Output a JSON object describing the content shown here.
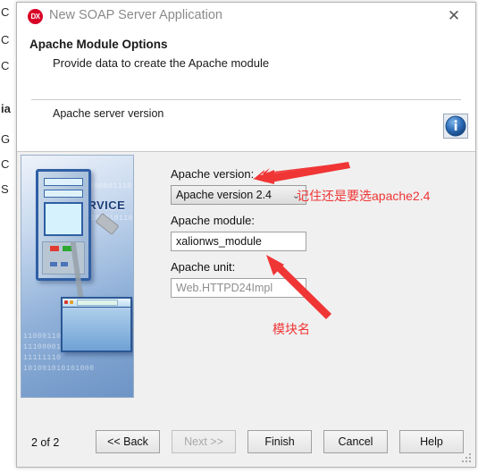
{
  "window": {
    "title": "New SOAP Server Application",
    "app_icon": "dx-logo-icon",
    "close_label": "✕"
  },
  "header": {
    "title": "Apache Module Options",
    "subtitle": "Provide data to create the Apache module",
    "section_label": "Apache server version",
    "info_icon": "info-icon"
  },
  "illustration": {
    "service_label": "SERVICE",
    "binary_rows": [
      "000000001110",
      "0100100010110",
      "11000110",
      "111000011",
      "11111110",
      "101001010101000"
    ]
  },
  "form": {
    "version_label": "Apache version:",
    "version_value": "Apache version 2.4",
    "version_options": [
      "Apache version 2.4"
    ],
    "version_arrow": "⌄",
    "module_label": "Apache module:",
    "module_value": "xalionws_module",
    "unit_label": "Apache unit:",
    "unit_value": "Web.HTTPD24Impl"
  },
  "footer": {
    "page_indicator": "2 of 2",
    "back_label": "<< Back",
    "next_label": "Next >>",
    "finish_label": "Finish",
    "cancel_label": "Cancel",
    "help_label": "Help"
  },
  "annotations": {
    "version_note": "记住还是要选apache2.4",
    "module_note": "模块名",
    "color": "#f03535"
  },
  "background_window": {
    "fragments": [
      "C",
      "C",
      "C",
      "ia",
      "G",
      "C",
      "S"
    ]
  }
}
